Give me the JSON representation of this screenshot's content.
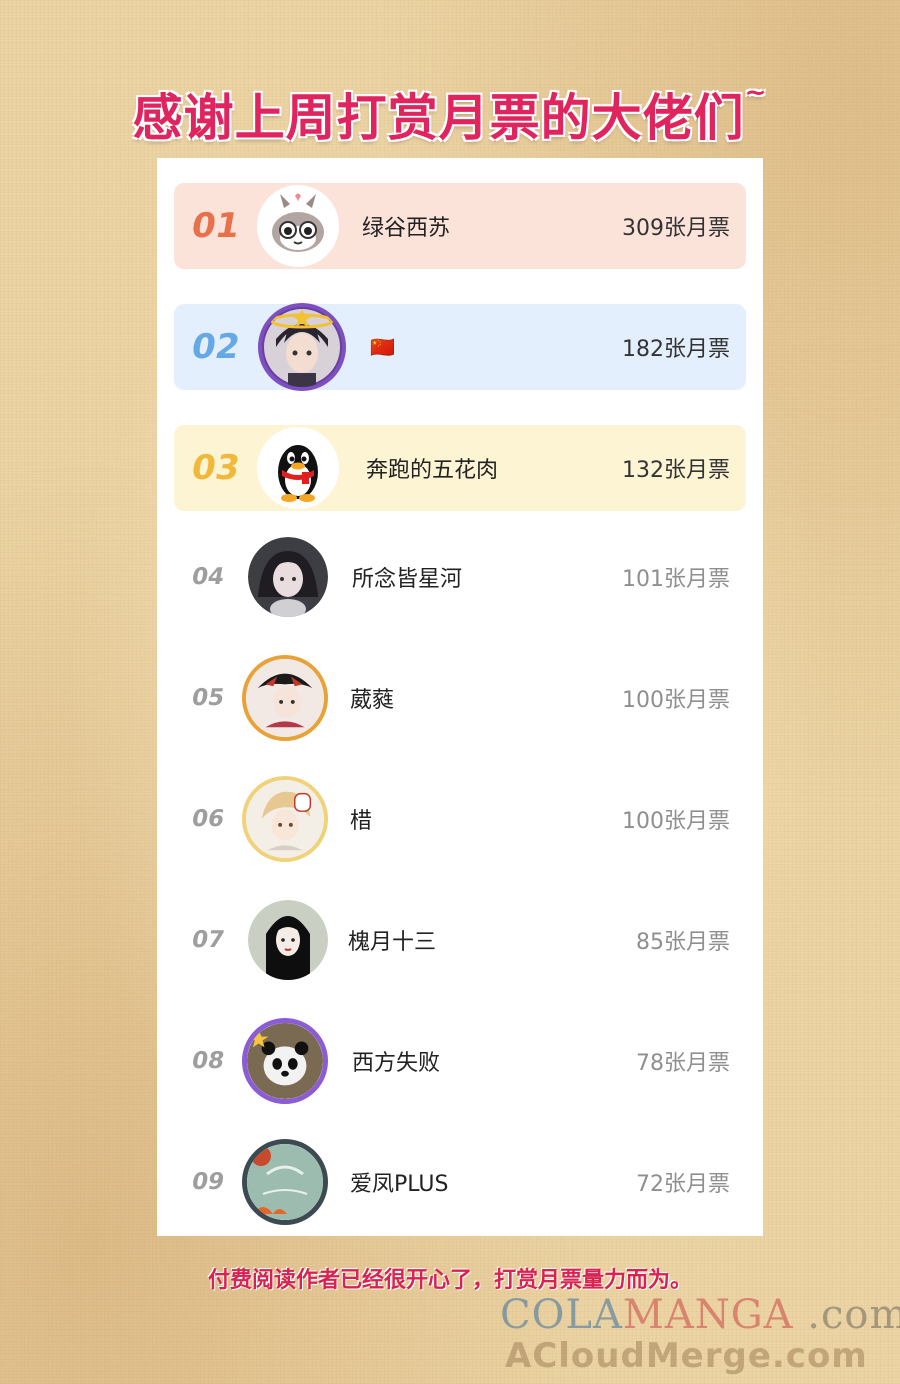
{
  "title": "感谢上周打赏月票的大佬们",
  "title_tilde": "~",
  "rows": [
    {
      "rank": "01",
      "name": "绿谷西苏",
      "votes": "309张月票",
      "bg": "#fbe3da",
      "rank_color": "#e8704a",
      "avatar": "rabbit-avatar-icon"
    },
    {
      "rank": "02",
      "name": "🇨🇳",
      "votes": "182张月票",
      "bg": "#e3effc",
      "rank_color": "#66a8e6",
      "avatar": "anime-boy-avatar-icon"
    },
    {
      "rank": "03",
      "name": "奔跑的五花肉",
      "votes": "132张月票",
      "bg": "#fdf4d4",
      "rank_color": "#f0b93a",
      "avatar": "qq-penguin-avatar-icon"
    },
    {
      "rank": "04",
      "name": "所念皆星河",
      "votes": "101张月票",
      "avatar": "girl-avatar-icon"
    },
    {
      "rank": "05",
      "name": "葳蕤",
      "votes": "100张月票",
      "avatar": "framed-avatar-icon"
    },
    {
      "rank": "06",
      "name": "棤",
      "votes": "100张月票",
      "avatar": "framed-avatar-icon"
    },
    {
      "rank": "07",
      "name": "槐月十三",
      "votes": "85张月票",
      "avatar": "lady-avatar-icon"
    },
    {
      "rank": "08",
      "name": "西方失败",
      "votes": "78张月票",
      "avatar": "panda-avatar-icon"
    },
    {
      "rank": "09",
      "name": "爱凤PLUS",
      "votes": "72张月票",
      "avatar": "framed-avatar-icon"
    }
  ],
  "footer": "付费阅读作者已经很开心了，打赏月票量力而为。",
  "watermark": {
    "line1_a": "COLA",
    "line1_b": "MANGA",
    "line1_c": " .com",
    "line2": "ACloudMerge.com"
  },
  "colors": {
    "title": "#e0245e",
    "footer": "#d8224f"
  }
}
